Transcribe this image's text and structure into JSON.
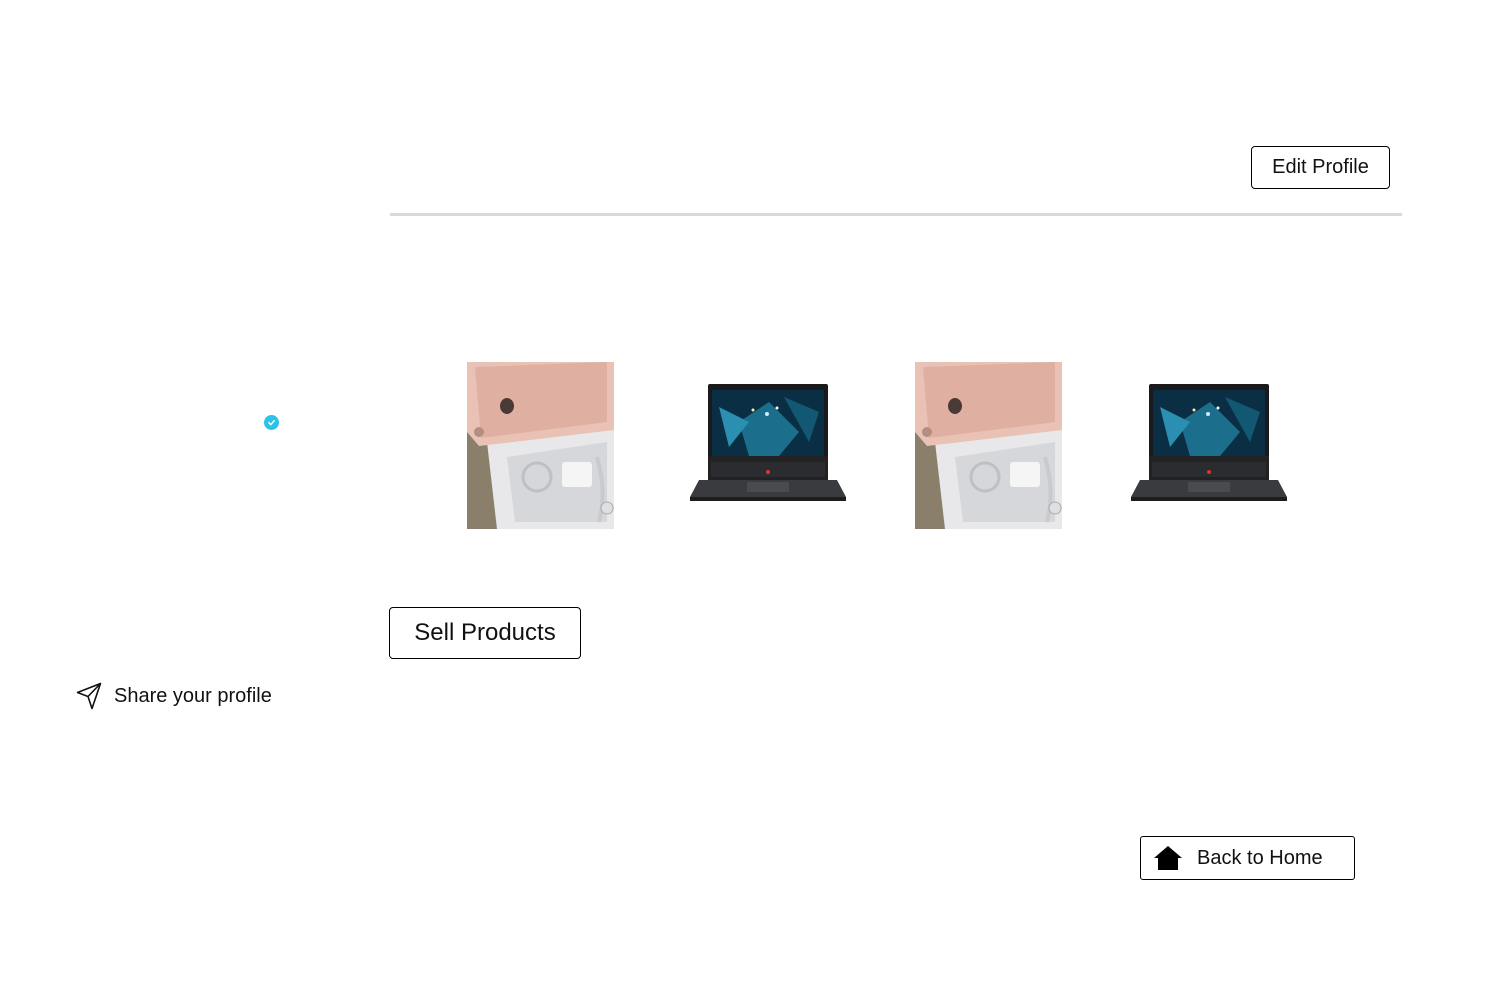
{
  "header": {
    "edit_profile_label": "Edit Profile"
  },
  "profile": {
    "verified_icon": "check-circle-icon",
    "verified_color": "#2bc4e8",
    "share_label": "Share your profile",
    "share_icon": "send-icon"
  },
  "products": [
    {
      "kind": "phone-box-photo"
    },
    {
      "kind": "laptop-photo"
    },
    {
      "kind": "phone-box-photo"
    },
    {
      "kind": "laptop-photo"
    }
  ],
  "actions": {
    "sell_products_label": "Sell Products",
    "back_home_label": "Back to Home",
    "back_home_icon": "home-icon"
  }
}
